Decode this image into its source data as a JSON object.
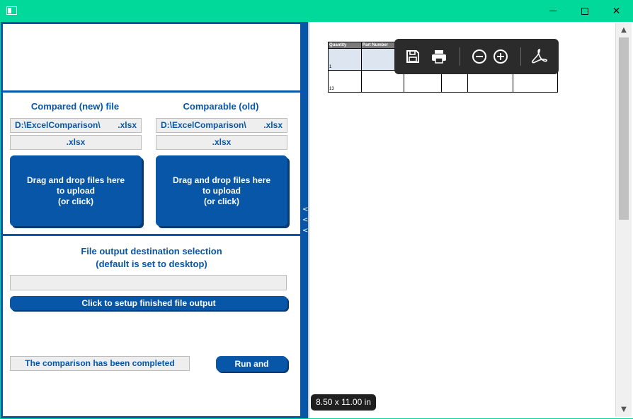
{
  "window": {
    "minimize_icon": "minimize-icon",
    "maximize_icon": "maximize-icon",
    "close_symbol": "✕",
    "accent_color": "#00d99a",
    "brand_color": "#0756a8"
  },
  "compare": {
    "new_title": "Compared (new) file",
    "old_title": "Comparable (old)",
    "new_path_prefix": "D:\\ExcelComparison\\",
    "new_path_ext": ".xlsx",
    "new_second_ext": ".xlsx",
    "old_path_prefix": "D:\\ExcelComparison\\",
    "old_path_ext": ".xlsx",
    "old_second_ext": ".xlsx",
    "drop_line1": "Drag and drop files here",
    "drop_line2": "to upload",
    "drop_line3": "(or click)"
  },
  "output": {
    "title_line1": "File output destination selection",
    "title_line2": "(default is set to desktop)",
    "input_value": "",
    "setup_button": "Click to setup finished file output",
    "status": "The comparison has been completed",
    "run_button": "Run and compare"
  },
  "splitter": {
    "arrows": [
      "<",
      "<",
      "<"
    ]
  },
  "pdf": {
    "table_headers": [
      "Quantity",
      "Part Number"
    ],
    "row_numbers": [
      "1",
      "13"
    ],
    "toolbar_icons": [
      "save-icon",
      "print-icon",
      "zoom-out-icon",
      "zoom-in-icon",
      "acrobat-icon"
    ],
    "page_size": "8.50 x 11.00 in"
  },
  "scrollbar": {
    "up": "▲",
    "down": "▼"
  }
}
